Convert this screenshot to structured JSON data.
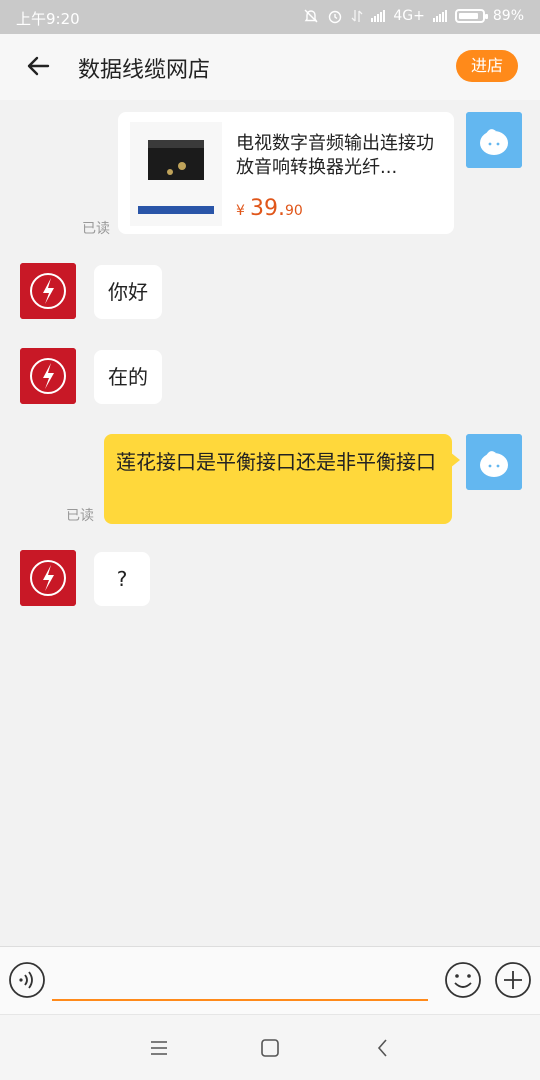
{
  "status_bar": {
    "time": "上午9:20",
    "network": "4G+",
    "battery": "89%",
    "battery_level": 0.89
  },
  "header": {
    "back_icon": "arrow-left-icon",
    "title": "数据线缆网店",
    "enter_shop_label": "进店"
  },
  "product_card": {
    "name": "电视数字音频输出连接功放音响转换器光纤...",
    "currency": "¥",
    "price_integer": "39.",
    "price_decimal": "90",
    "read_label": "已读"
  },
  "messages": [
    {
      "sender": "shop",
      "text": "你好"
    },
    {
      "sender": "shop",
      "text": "在的"
    },
    {
      "sender": "user",
      "text": "莲花接口是平衡接口还是非平衡接口",
      "read_label": "已读"
    },
    {
      "sender": "shop",
      "text": "?"
    }
  ],
  "input_bar": {
    "voice_icon": "voice-icon",
    "placeholder": "",
    "value": "",
    "emoji_icon": "emoji-icon",
    "plus_icon": "plus-icon"
  },
  "colors": {
    "accent": "#ff8a1a",
    "outgoing_bubble": "#ffd83b",
    "incoming_bubble": "#ffffff",
    "price": "#e0561a",
    "shop_avatar": "#c81826",
    "user_avatar": "#63b7f0"
  }
}
